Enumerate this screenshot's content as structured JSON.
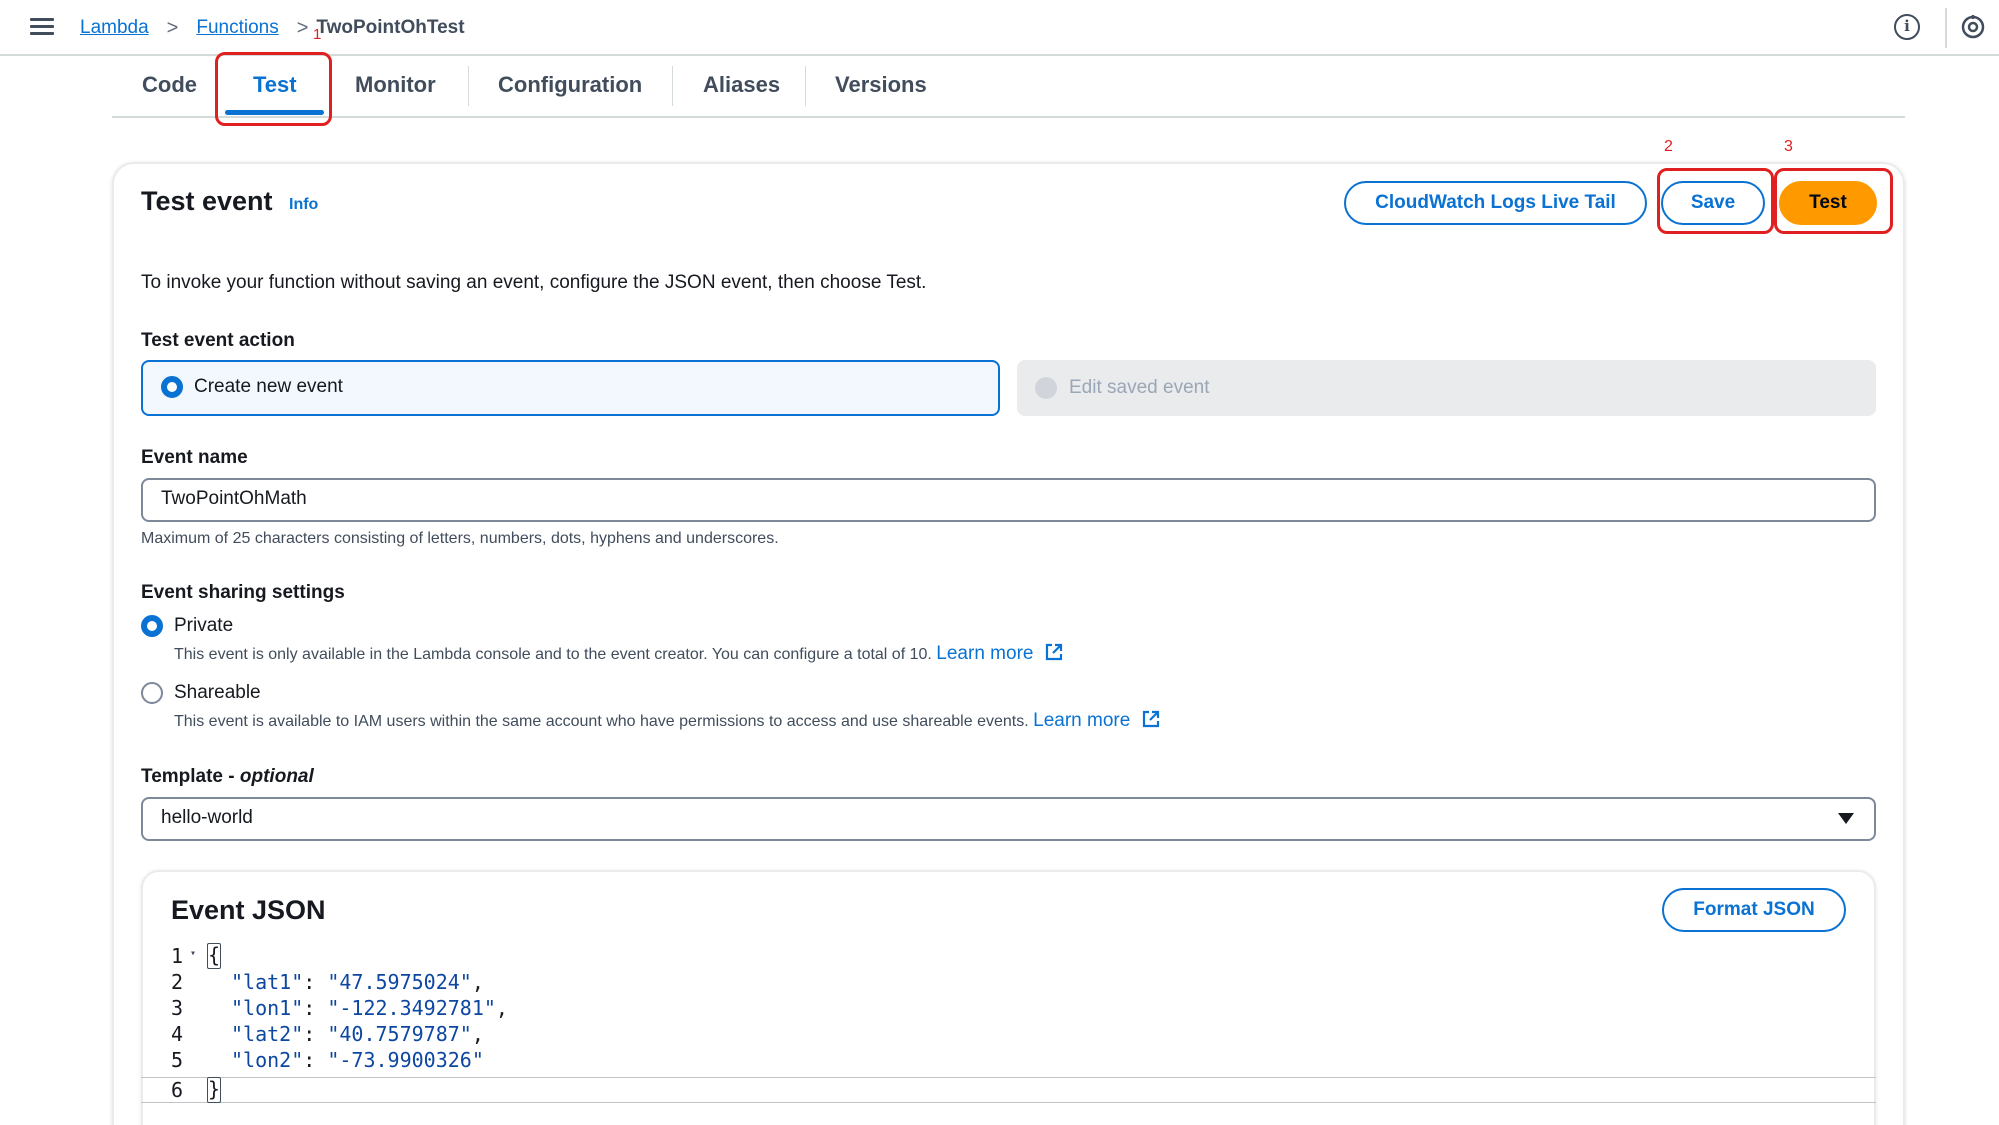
{
  "breadcrumb": {
    "lambda": "Lambda",
    "functions": "Functions",
    "current": "TwoPointOhTest",
    "sep": ">",
    "annotation": "1"
  },
  "tabs": [
    {
      "label": "Code"
    },
    {
      "label": "Test"
    },
    {
      "label": "Monitor"
    },
    {
      "label": "Configuration"
    },
    {
      "label": "Aliases"
    },
    {
      "label": "Versions"
    }
  ],
  "panel": {
    "title": "Test event",
    "info": "Info",
    "buttons": {
      "live_tail": "CloudWatch Logs Live Tail",
      "save": "Save",
      "test": "Test"
    },
    "annotations": {
      "save": "2",
      "test": "3"
    },
    "description": "To invoke your function without saving an event, configure the JSON event, then choose Test."
  },
  "test_event_action": {
    "label": "Test event action",
    "options": [
      {
        "label": "Create new event",
        "selected": true
      },
      {
        "label": "Edit saved event",
        "disabled": true
      }
    ]
  },
  "event_name": {
    "label": "Event name",
    "value": "TwoPointOhMath",
    "hint": "Maximum of 25 characters consisting of letters, numbers, dots, hyphens and underscores."
  },
  "sharing": {
    "label": "Event sharing settings",
    "private_label": "Private",
    "private_desc": "This event is only available in the Lambda console and to the event creator. You can configure a total of 10.",
    "shareable_label": "Shareable",
    "shareable_desc": "This event is available to IAM users within the same account who have permissions to access and use shareable events.",
    "learn_more": "Learn more"
  },
  "template": {
    "label": "Template - ",
    "optional": "optional",
    "value": "hello-world"
  },
  "event_json": {
    "title": "Event JSON",
    "format_button": "Format JSON",
    "lines": [
      {
        "n": "1",
        "text": "{"
      },
      {
        "n": "2",
        "key": "\"lat1\"",
        "value": "\"47.5975024\"",
        "comma": ","
      },
      {
        "n": "3",
        "key": "\"lon1\"",
        "value": "\"-122.3492781\"",
        "comma": ","
      },
      {
        "n": "4",
        "key": "\"lat2\"",
        "value": "\"40.7579787\"",
        "comma": ","
      },
      {
        "n": "5",
        "key": "\"lon2\"",
        "value": "\"-73.9900326\"",
        "comma": ""
      },
      {
        "n": "6",
        "text": "}"
      }
    ]
  },
  "colors": {
    "accent": "#0972d3",
    "primary_button": "#ff9900",
    "annotation": "#e02020"
  }
}
